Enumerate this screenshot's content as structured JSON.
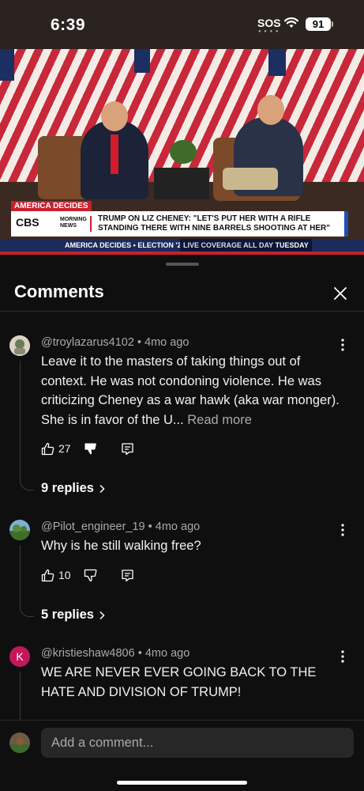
{
  "status": {
    "time": "6:39",
    "sos": "SOS",
    "battery": "91"
  },
  "video": {
    "tag": "AMERICA DECIDES",
    "network_logo": "CBS",
    "network_sub": "MORNING NEWS",
    "headline": "TRUMP ON LIZ CHENEY: \"LET'S PUT HER WITH A RIFLE STANDING THERE WITH NINE BARRELS SHOOTING AT HER\"",
    "ticker_left": "AMERICA DECIDES • ELECTION '24",
    "ticker_right_prefix": "LIVE COVERAGE ALL DAY ",
    "ticker_right_bold": "TUESDAY"
  },
  "comments_panel": {
    "title": "Comments",
    "comments": [
      {
        "author": "@troylazarus4102",
        "time": "4mo ago",
        "text": "Leave it to the masters of taking things out of context.  He was not condoning violence.  He was criticizing Cheney as a war hawk (aka war monger).  She is in favor of the U...",
        "read_more": "Read more",
        "likes": "27",
        "replies": "9 replies",
        "avatar_color": "#7a8a6a"
      },
      {
        "author": "@Pilot_engineer_19",
        "time": "4mo ago",
        "text": "Why is he still walking free?",
        "likes": "10",
        "replies": "5 replies",
        "avatar_color": "#4f7a3a"
      },
      {
        "author": "@kristieshaw4806",
        "time": "4mo ago",
        "text": "WE ARE NEVER EVER GOING BACK TO THE HATE AND DIVISION OF TRUMP!",
        "avatar_letter": "K",
        "avatar_color": "#c2185b"
      }
    ],
    "add_comment_placeholder": "Add a comment..."
  }
}
